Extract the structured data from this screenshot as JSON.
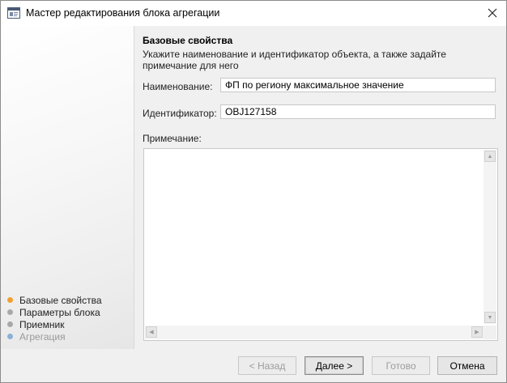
{
  "window": {
    "title": "Мастер редактирования блока агрегации"
  },
  "sidebar": {
    "steps": [
      {
        "label": "Базовые свойства",
        "color": "#f0a030",
        "state": "current"
      },
      {
        "label": "Параметры блока",
        "color": "#a8a8a8",
        "state": "pending"
      },
      {
        "label": "Приемник",
        "color": "#a8a8a8",
        "state": "pending"
      },
      {
        "label": "Агрегация",
        "color": "#8ab0d8",
        "state": "disabled"
      }
    ]
  },
  "main": {
    "heading": "Базовые свойства",
    "description": "Укажите наименование и идентификатор объекта, а также задайте примечание для него",
    "name_label": "Наименование:",
    "name_value": "ФП по региону максимальное значение",
    "id_label": "Идентификатор:",
    "id_value": "OBJ127158",
    "note_label": "Примечание:",
    "note_value": ""
  },
  "footer": {
    "back_label": "< Назад",
    "next_label": "Далее >",
    "finish_label": "Готово",
    "cancel_label": "Отмена"
  },
  "icons": {
    "app": "wizard-window-icon",
    "close": "close-icon"
  }
}
